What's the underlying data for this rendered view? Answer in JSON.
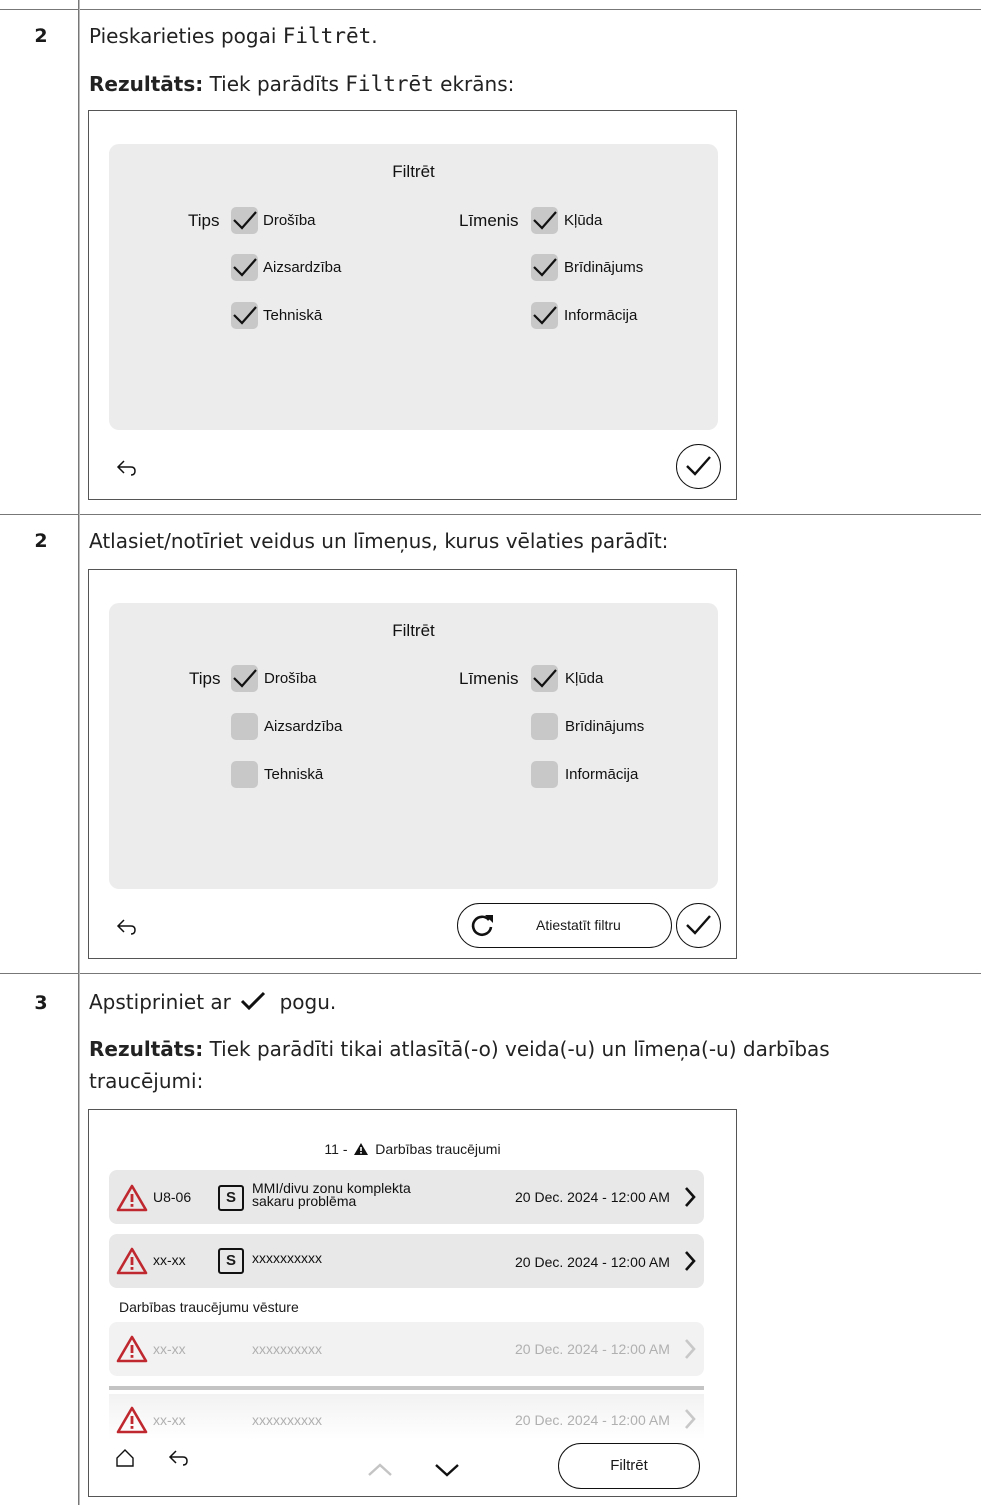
{
  "rows": [
    {
      "step": "2",
      "text_prefix": "Pieskarieties pogai ",
      "text_mono": "Filtrēt",
      "text_suffix": ".",
      "result_label": "Rezultāts:",
      "result_prefix": " Tiek parādīts ",
      "result_mono": "Filtrēt",
      "result_suffix": " ekrāns:"
    },
    {
      "step": "2",
      "text": "Atlasiet/notīriet veidus un līmeņus, kurus vēlaties parādīt:"
    },
    {
      "step": "3",
      "text_prefix": "Apstipriniet ar ",
      "text_suffix": " pogu.",
      "result_label": "Rezultāts:",
      "result_line1": " Tiek parādīti tikai atlasītā(-o) veida(-u) un līmeņa(-u) darbības",
      "result_line2": "traucējumi:"
    }
  ],
  "filter_screen_1": {
    "title": "Filtrēt",
    "type_label": "Tips",
    "level_label": "Līmenis",
    "types": [
      {
        "label": "Drošība",
        "checked": true
      },
      {
        "label": "Aizsardzība",
        "checked": true
      },
      {
        "label": "Tehniskā",
        "checked": true
      }
    ],
    "levels": [
      {
        "label": "Kļūda",
        "checked": true
      },
      {
        "label": "Brīdinājums",
        "checked": true
      },
      {
        "label": "Informācija",
        "checked": true
      }
    ],
    "back_icon": "back-arrow-icon",
    "ok_icon": "checkmark-icon"
  },
  "filter_screen_2": {
    "title": "Filtrēt",
    "type_label": "Tips",
    "level_label": "Līmenis",
    "types": [
      {
        "label": "Drošība",
        "checked": true
      },
      {
        "label": "Aizsardzība",
        "checked": false
      },
      {
        "label": "Tehniskā",
        "checked": false
      }
    ],
    "levels": [
      {
        "label": "Kļūda",
        "checked": true
      },
      {
        "label": "Brīdinājums",
        "checked": false
      },
      {
        "label": "Informācija",
        "checked": false
      }
    ],
    "reset_label": "Atiestatīt filtru",
    "back_icon": "back-arrow-icon",
    "reset_icon": "refresh-icon",
    "ok_icon": "checkmark-icon"
  },
  "malfunctions_screen": {
    "title_count": "11 -",
    "title_text": "Darbības traucējumi",
    "current": [
      {
        "code": "U8-06",
        "type_badge": "S",
        "description_line1": "MMI/divu zonu komplekta",
        "description_line2": "sakaru problēma",
        "datetime": "20 Dec. 2024 - 12:00 AM"
      },
      {
        "code": "xx-xx",
        "type_badge": "S",
        "description_line1": "xxxxxxxxxx",
        "description_line2": "",
        "datetime": "20 Dec. 2024 - 12:00 AM"
      }
    ],
    "history_label": "Darbības traucējumu vēsture",
    "history": [
      {
        "code": "xx-xx",
        "description": "xxxxxxxxxx",
        "datetime": "20 Dec. 2024 - 12:00 AM"
      },
      {
        "code": "xx-xx",
        "description": "xxxxxxxxxx",
        "datetime": "20 Dec. 2024 - 12:00 AM"
      }
    ],
    "filter_button": "Filtrēt",
    "colors": {
      "warning_red": "#c0282f",
      "panel_grey": "#e8e8e8",
      "faded_text": "#b0b0b0"
    }
  }
}
